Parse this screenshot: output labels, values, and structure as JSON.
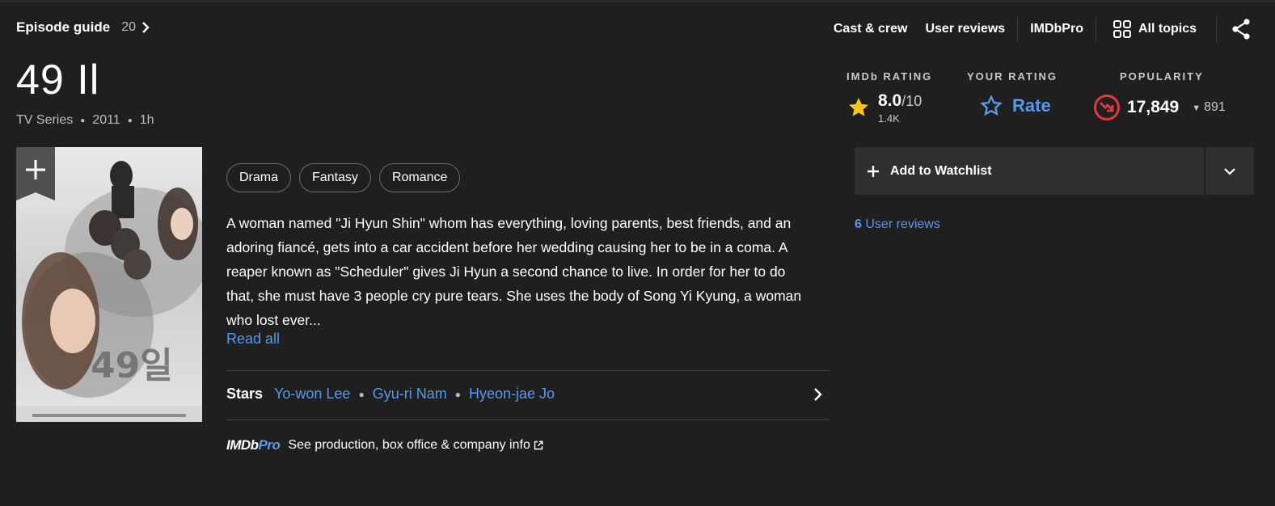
{
  "header": {
    "episode_guide_label": "Episode guide",
    "episode_count": "20",
    "nav": [
      "Cast & crew",
      "User reviews",
      "IMDbPro",
      "All topics"
    ]
  },
  "title": {
    "name": "49 Il",
    "type": "TV Series",
    "year": "2011",
    "runtime": "1h"
  },
  "ratings": {
    "imdb_heading": "IMDb RATING",
    "imdb_value": "8.0",
    "imdb_scale": "/10",
    "imdb_votes": "1.4K",
    "your_heading": "YOUR RATING",
    "rate_label": "Rate",
    "popularity_heading": "POPULARITY",
    "popularity_value": "17,849",
    "popularity_change": "891"
  },
  "genres": [
    "Drama",
    "Fantasy",
    "Romance"
  ],
  "plot": "A woman named \"Ji Hyun Shin\" whom has everything, loving parents, best friends, and an adoring fiancé, gets into a car accident before her wedding causing her to be in a coma. A reaper known as \"Scheduler\" gives Ji Hyun a second chance to live. In order for her to do that, she must have 3 people cry pure tears. She uses the body of Song Yi Kyung, a woman who lost ever...",
  "read_all": "Read all",
  "stars": {
    "label": "Stars",
    "names": [
      "Yo-won Lee",
      "Gyu-ri Nam",
      "Hyeon-jae Jo"
    ]
  },
  "imdbpro": {
    "logo_imdb": "IMDb",
    "logo_pro": "Pro",
    "text": "See production, box office & company info"
  },
  "watchlist": {
    "label": "Add to Watchlist"
  },
  "user_reviews": {
    "count": "6",
    "label": "User reviews"
  },
  "poster": {
    "text": "49일"
  },
  "colors": {
    "background": "#1f1f1f",
    "link": "#5799ef",
    "star": "#f5c518",
    "popularity_down": "#e2383f"
  }
}
